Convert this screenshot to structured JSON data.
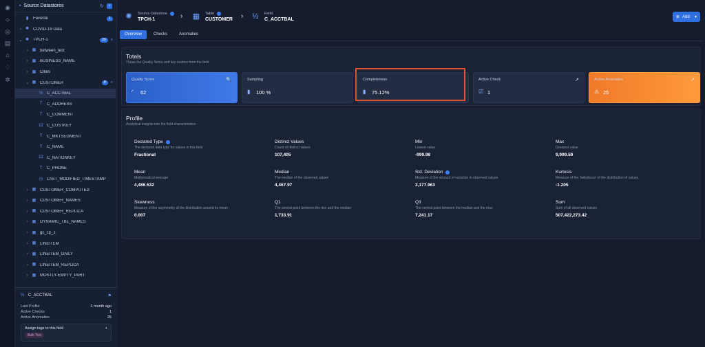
{
  "sidebar": {
    "title": "Source Datastores",
    "tree": [
      {
        "label": "Favorite",
        "icon": "bookmark-icon",
        "chev": "",
        "indent": 0,
        "badge": "1"
      },
      {
        "label": "COVID-19 Data",
        "icon": "datastore-icon",
        "chev": "›",
        "indent": 0
      },
      {
        "label": "TPCH-1",
        "icon": "datastore-icon",
        "chev": "⌄",
        "indent": 0,
        "badge": "29",
        "search": true
      },
      {
        "label": "between_test",
        "icon": "table-icon",
        "chev": "›",
        "indent": 1
      },
      {
        "label": "BUSINESS_NAME",
        "icon": "table-icon",
        "chev": "›",
        "indent": 1
      },
      {
        "label": "Cities",
        "icon": "table-icon",
        "chev": "›",
        "indent": 1
      },
      {
        "label": "CUSTOMER",
        "icon": "table-icon",
        "chev": "⌄",
        "indent": 1,
        "badge": "8",
        "search": true
      },
      {
        "label": "C_ACCTBAL",
        "icon": "decimal-icon",
        "chev": "",
        "indent": 2,
        "selected": true
      },
      {
        "label": "C_ADDRESS",
        "icon": "text-icon",
        "chev": "",
        "indent": 2
      },
      {
        "label": "C_COMMENT",
        "icon": "text-icon",
        "chev": "",
        "indent": 2
      },
      {
        "label": "C_CUSTKEY",
        "icon": "integer-icon",
        "chev": "",
        "indent": 2
      },
      {
        "label": "C_MKTSEGMENT",
        "icon": "text-icon",
        "chev": "",
        "indent": 2
      },
      {
        "label": "C_NAME",
        "icon": "text-icon",
        "chev": "",
        "indent": 2
      },
      {
        "label": "C_NATIONKEY",
        "icon": "integer-icon",
        "chev": "",
        "indent": 2
      },
      {
        "label": "C_PHONE",
        "icon": "text-icon",
        "chev": "",
        "indent": 2
      },
      {
        "label": "LAST_MODIFIED_TIMESTAMP",
        "icon": "clock-icon",
        "chev": "",
        "indent": 2
      },
      {
        "label": "CUSTOMER_COMPUTED",
        "icon": "table-icon",
        "chev": "›",
        "indent": 1
      },
      {
        "label": "CUSTOMER_NAMES",
        "icon": "table-icon",
        "chev": "›",
        "indent": 1
      },
      {
        "label": "CUSTOMER_REPLICA",
        "icon": "table-icon",
        "chev": "›",
        "indent": 1
      },
      {
        "label": "DYNAMIC_TBL_NAMES",
        "icon": "table-icon",
        "chev": "›",
        "indent": 1
      },
      {
        "label": "gc_cp_1",
        "icon": "table-icon",
        "chev": "›",
        "indent": 1
      },
      {
        "label": "LINEITEM",
        "icon": "table-icon",
        "chev": "›",
        "indent": 1
      },
      {
        "label": "LINEITEM_DAILY",
        "icon": "table-icon",
        "chev": "›",
        "indent": 1
      },
      {
        "label": "LINEITEM_REPLICA",
        "icon": "table-icon",
        "chev": "›",
        "indent": 1
      },
      {
        "label": "MOSTLY-EMPTY_PART",
        "icon": "table-icon",
        "chev": "›",
        "indent": 1
      }
    ],
    "field_info": {
      "name": "C_ACCTBAL",
      "rows": [
        {
          "k": "Last Profile",
          "v": "1 month ago"
        },
        {
          "k": "Active Checks",
          "v": "1"
        },
        {
          "k": "Active Anomalies",
          "v": "25"
        }
      ],
      "tags_label": "Assign tags to this field",
      "tag": "Bulk Test"
    }
  },
  "breadcrumb": [
    {
      "type": "Source Datastore",
      "name": "TPCH-1",
      "info": true
    },
    {
      "type": "Table",
      "name": "CUSTOMER",
      "info": true
    },
    {
      "type": "Field",
      "name": "C_ACCTBAL",
      "info": false
    }
  ],
  "add_button": "Add",
  "tabs": [
    "Overview",
    "Checks",
    "Anomalies"
  ],
  "totals": {
    "title": "Totals",
    "subtitle": "These the Quality Score and key metrics from the field",
    "metrics": [
      {
        "label": "Quality Score",
        "value": "62",
        "icon": "gauge-icon",
        "right": "🔍"
      },
      {
        "label": "Sampling",
        "value": "100 %",
        "icon": "bar-icon",
        "right": ""
      },
      {
        "label": "Completeness",
        "value": "75.12%",
        "icon": "bar-icon",
        "right": ""
      },
      {
        "label": "Active Check",
        "value": "1",
        "icon": "check-icon",
        "right": "↗"
      },
      {
        "label": "Active Anomalies",
        "value": "25",
        "icon": "warning-icon",
        "right": "↗"
      }
    ]
  },
  "profile": {
    "title": "Profile",
    "subtitle": "Analytical insights into the field characteristics",
    "cells": [
      {
        "k": "Declared Type",
        "d": "The declared data type for values in this field",
        "v": "Fractional",
        "info": true
      },
      {
        "k": "Distinct Values",
        "d": "Count of distinct values",
        "v": "107,405"
      },
      {
        "k": "Min",
        "d": "Lowest value",
        "v": "-999.98"
      },
      {
        "k": "Max",
        "d": "Greatest value",
        "v": "9,999.59"
      },
      {
        "k": "Mean",
        "d": "Mathematical average",
        "v": "4,486.532"
      },
      {
        "k": "Median",
        "d": "The median of the observed values",
        "v": "4,467.97"
      },
      {
        "k": "Std. Deviation",
        "d": "Measure of the amount of variation in observed values",
        "v": "3,177.963",
        "info": true
      },
      {
        "k": "Kurtosis",
        "d": "Measure of the 'tailedness' of the distribution of values",
        "v": "-1.205"
      },
      {
        "k": "Skewness",
        "d": "Measure of the asymmetry of the distribution around its mean",
        "v": "0.007"
      },
      {
        "k": "Q1",
        "d": "The central point between the min and the median",
        "v": "1,733.91"
      },
      {
        "k": "Q3",
        "d": "The central point between the median and the max",
        "v": "7,241.17"
      },
      {
        "k": "Sum",
        "d": "Sum of all observed values",
        "v": "507,422,273.42"
      }
    ]
  }
}
